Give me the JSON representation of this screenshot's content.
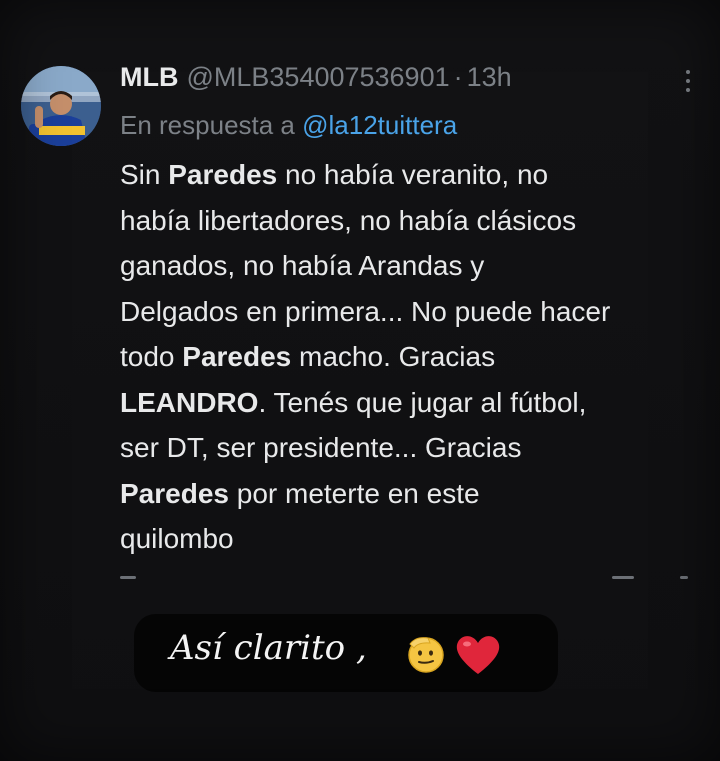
{
  "tweet": {
    "author_name": "MLB",
    "author_handle": "@MLB354007536901",
    "separator": "·",
    "time": "13h",
    "reply_prefix": "En respuesta a",
    "reply_mention": "@la12tuittera",
    "body_lines": [
      [
        {
          "t": "Sin "
        },
        {
          "t": "Paredes",
          "b": true
        },
        {
          "t": " no había veranito, no"
        }
      ],
      [
        {
          "t": "había libertadores, no había clásicos"
        }
      ],
      [
        {
          "t": "ganados, no había Arandas y"
        }
      ],
      [
        {
          "t": "Delgados en primera... No puede hacer"
        }
      ],
      [
        {
          "t": "todo "
        },
        {
          "t": "Paredes",
          "b": true
        },
        {
          "t": " macho. Gracias"
        }
      ],
      [
        {
          "t": "LEANDRO",
          "b": true
        },
        {
          "t": ". Tenés que jugar al fútbol,"
        }
      ],
      [
        {
          "t": "ser DT, ser presidente... Gracias"
        }
      ],
      [
        {
          "t": "Paredes",
          "b": true
        },
        {
          "t": " por meterte en este"
        }
      ],
      [
        {
          "t": "quilombo"
        }
      ]
    ],
    "more_icon": "more-vertical-icon",
    "avatar_icon": "user-avatar"
  },
  "caption": {
    "text": "Así clarito ,",
    "emoji_1": "saluting-face-emoji",
    "emoji_2": "red-heart-emoji"
  },
  "colors": {
    "background": "#0f0f11",
    "text_primary": "#e8e9ea",
    "text_secondary": "#7c8187",
    "link": "#4aa3e8",
    "caption_bg": "#050505",
    "heart": "#e0263b",
    "emoji_face": "#f5c542"
  }
}
